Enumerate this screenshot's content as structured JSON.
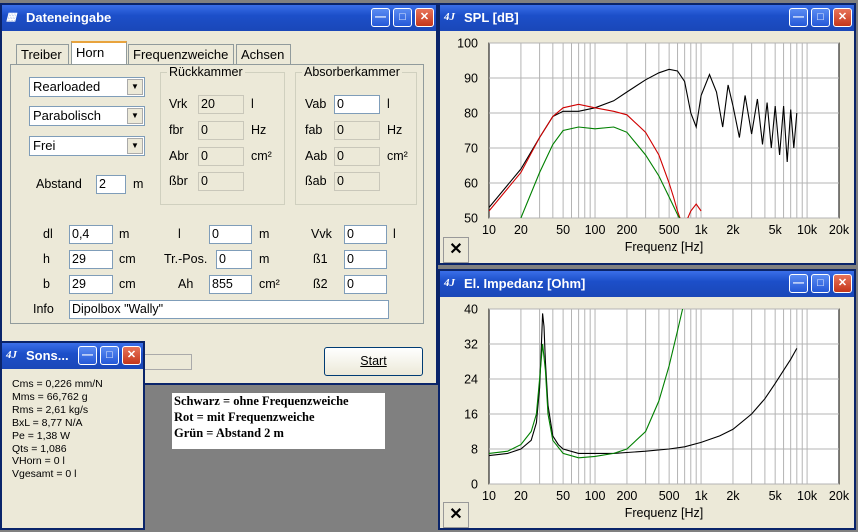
{
  "main_window": {
    "title": "Dateneingabe",
    "tabs": [
      "Treiber",
      "Horn",
      "Frequenzweiche",
      "Achsen"
    ],
    "active_tab": "Horn",
    "combos": [
      "Rearloaded",
      "Parabolisch",
      "Frei"
    ],
    "abstand": {
      "label": "Abstand",
      "value": "2",
      "unit": "m"
    },
    "rueckkammer": {
      "title": "Rückkammer",
      "rows": [
        {
          "label": "Vrk",
          "value": "20",
          "unit": "l"
        },
        {
          "label": "fbr",
          "value": "0",
          "unit": "Hz"
        },
        {
          "label": "Abr",
          "value": "0",
          "unit": "cm²"
        },
        {
          "label": "ßbr",
          "value": "0",
          "unit": ""
        }
      ]
    },
    "absorberkammer": {
      "title": "Absorberkammer",
      "rows": [
        {
          "label": "Vab",
          "value": "0",
          "unit": "l"
        },
        {
          "label": "fab",
          "value": "0",
          "unit": "Hz"
        },
        {
          "label": "Aab",
          "value": "0",
          "unit": "cm²"
        },
        {
          "label": "ßab",
          "value": "0",
          "unit": ""
        }
      ]
    },
    "params": {
      "dl": {
        "label": "dl",
        "value": "0,4",
        "unit": "m"
      },
      "h": {
        "label": "h",
        "value": "29",
        "unit": "cm"
      },
      "b": {
        "label": "b",
        "value": "29",
        "unit": "cm"
      },
      "l": {
        "label": "l",
        "value": "0",
        "unit": "m"
      },
      "trpos": {
        "label": "Tr.-Pos.",
        "value": "0",
        "unit": "m"
      },
      "ah": {
        "label": "Ah",
        "value": "855",
        "unit": "cm²"
      },
      "vvk": {
        "label": "Vvk",
        "value": "0",
        "unit": "l"
      },
      "b1": {
        "label": "ß1",
        "value": "0"
      },
      "b2": {
        "label": "ß2",
        "value": "0"
      }
    },
    "info": {
      "label": "Info",
      "value": "Dipolbox \"Wally\""
    },
    "start_label": "Start"
  },
  "legend_note": {
    "lines": [
      "Schwarz = ohne Frequenzweiche",
      "Rot = mit Frequenzweiche",
      "Grün = Abstand 2 m"
    ]
  },
  "sons_window": {
    "title": "Sons...",
    "lines": [
      "Cms = 0,226 mm/N",
      "Mms = 66,762 g",
      "Rms = 2,61 kg/s",
      "BxL = 8,77 N/A",
      "Pe = 1,38 W",
      "Qts = 1,086",
      "VHorn = 0 l",
      "Vgesamt = 0 l"
    ]
  },
  "chart_data": [
    {
      "type": "line",
      "window_title": "SPL [dB]",
      "xlabel": "Frequenz [Hz]",
      "x_scale": "log",
      "xlim": [
        10,
        20000
      ],
      "ylim": [
        50,
        100
      ],
      "x_ticks": [
        "10",
        "20",
        "50",
        "100",
        "200",
        "500",
        "1k",
        "2k",
        "5k",
        "10k",
        "20k"
      ],
      "y_ticks": [
        "100",
        "90",
        "80",
        "70",
        "60",
        "50"
      ],
      "grid": true,
      "colors": {
        "black": "#000000",
        "red": "#d00000",
        "green": "#008000"
      },
      "series": [
        {
          "color": "black",
          "x": [
            10,
            20,
            30,
            40,
            50,
            70,
            100,
            150,
            200,
            300,
            400,
            500,
            600,
            700,
            800,
            900,
            1000,
            1200,
            1400,
            1600,
            1800,
            2000,
            2300,
            2600,
            3000,
            3400,
            3800,
            4200,
            4600,
            5000,
            5500,
            6000,
            6500,
            7000,
            7500,
            8000
          ],
          "y": [
            53,
            64,
            73,
            79,
            80.5,
            80.5,
            81.5,
            83.5,
            86,
            89.5,
            91.5,
            92.5,
            92,
            89,
            80,
            76,
            85,
            91,
            86,
            76,
            88,
            82,
            73,
            85,
            74,
            84,
            71,
            83,
            70,
            82,
            68,
            82,
            66,
            81,
            70,
            80
          ]
        },
        {
          "color": "red",
          "x": [
            10,
            20,
            30,
            40,
            50,
            70,
            100,
            150,
            200,
            300,
            400,
            500,
            550,
            600,
            650,
            700,
            750,
            800,
            900,
            1000
          ],
          "y": [
            52,
            63,
            73,
            79,
            81.5,
            82.5,
            81.5,
            80.5,
            79.5,
            74.5,
            68,
            60,
            56,
            52,
            49,
            48,
            50,
            52,
            54,
            52
          ]
        },
        {
          "color": "green",
          "x": [
            20,
            30,
            40,
            50,
            70,
            100,
            150,
            200,
            300,
            400,
            500,
            600,
            650,
            700
          ],
          "y": [
            50,
            63,
            71,
            75,
            76,
            75.5,
            76,
            74.5,
            68,
            62,
            56,
            51,
            49,
            47
          ]
        }
      ]
    },
    {
      "type": "line",
      "window_title": "El. Impedanz [Ohm]",
      "xlabel": "Frequenz [Hz]",
      "x_scale": "log",
      "xlim": [
        10,
        20000
      ],
      "ylim": [
        0,
        40
      ],
      "x_ticks": [
        "10",
        "20",
        "50",
        "100",
        "200",
        "500",
        "1k",
        "2k",
        "5k",
        "10k",
        "20k"
      ],
      "y_ticks": [
        "40",
        "32",
        "24",
        "16",
        "8",
        "0"
      ],
      "grid": true,
      "colors": {
        "black": "#000000",
        "green": "#008000"
      },
      "series": [
        {
          "color": "black",
          "x": [
            10,
            15,
            20,
            25,
            28,
            30,
            31,
            32,
            33,
            34,
            36,
            40,
            45,
            50,
            70,
            100,
            150,
            200,
            300,
            500,
            700,
            1000,
            1500,
            2000,
            3000,
            4000,
            5000,
            6000,
            7000,
            8000
          ],
          "y": [
            6.5,
            7,
            8,
            10,
            14,
            22,
            30,
            39,
            36,
            28,
            18,
            11,
            9,
            8,
            7,
            7,
            7,
            7.2,
            7.5,
            8,
            8.5,
            9.5,
            11,
            12.5,
            16,
            19.5,
            23,
            26,
            28.5,
            31
          ]
        },
        {
          "color": "green",
          "x": [
            10,
            15,
            20,
            25,
            28,
            30,
            32,
            34,
            36,
            40,
            50,
            70,
            100,
            150,
            200,
            300,
            400,
            500,
            600,
            700
          ],
          "y": [
            7,
            7.5,
            9,
            12,
            16,
            24,
            32,
            26,
            16,
            10,
            7,
            6,
            6.3,
            7,
            8,
            12,
            19,
            27,
            35,
            42
          ]
        }
      ]
    }
  ]
}
